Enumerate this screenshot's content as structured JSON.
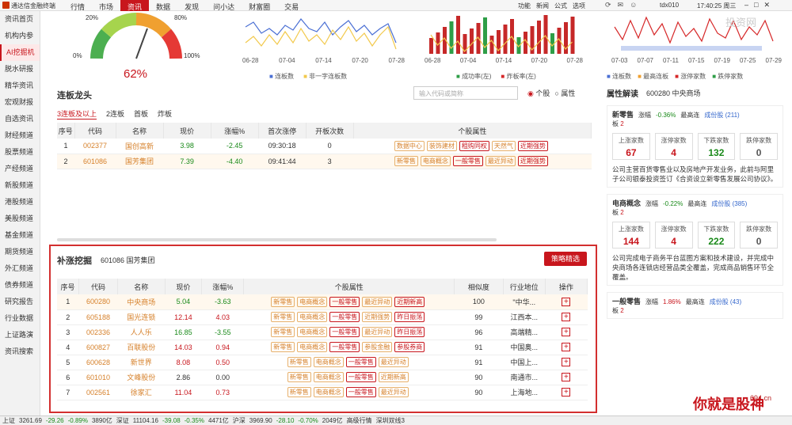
{
  "app": {
    "title": "通达信金融终端"
  },
  "menu": [
    "行情",
    "市场",
    "资讯",
    "数据",
    "发现",
    "问小达",
    "财富圈",
    "交易"
  ],
  "menu_active": "资讯",
  "right_menu": [
    "功能",
    "新闻",
    "公式",
    "选项"
  ],
  "account": "tdx010",
  "clock": "17:40:25 周三",
  "sidebar": [
    "资讯首页",
    "机构内参",
    "AI挖掘机",
    "脱水研报",
    "精华资讯",
    "宏观财报",
    "自选资讯",
    "财经频道",
    "股票频道",
    "产经频道",
    "新股频道",
    "港股频道",
    "美股频道",
    "基金频道",
    "期货频道",
    "外汇频道",
    "债券频道",
    "研究报告",
    "行业数据",
    "上证路演",
    "资讯搜索"
  ],
  "sidebar_active": "AI挖掘机",
  "gauge": {
    "value": "62%",
    "l20": "20%",
    "l80": "80%",
    "l0": "0%",
    "l100": "100%"
  },
  "chart1": {
    "legend": [
      "连板数",
      "非一字连板数"
    ],
    "x": [
      "06-28",
      "07-04",
      "07-14",
      "07-20",
      "07-28"
    ]
  },
  "chart2": {
    "legend": [
      "成功率(左)",
      "炸板率(左)"
    ],
    "x": [
      "06-28",
      "07-04",
      "07-14",
      "07-20",
      "07-28"
    ]
  },
  "chart3": {
    "legend": [
      "连板数",
      "最高连板",
      "涨停家数",
      "跌停家数"
    ],
    "x": [
      "07-03",
      "07-07",
      "07-11",
      "07-15",
      "07-19",
      "07-25",
      "07-29"
    ]
  },
  "dragon": {
    "title": "连板龙头",
    "search_placeholder": "输入代码或简称",
    "radio1": "个股",
    "radio2": "属性",
    "tabs": [
      "3连板及以上",
      "2连板",
      "首板",
      "炸板"
    ],
    "headers": [
      "序号",
      "代码",
      "名称",
      "现价",
      "涨幅%",
      "首次涨停",
      "开板次数",
      "个股属性"
    ],
    "rows": [
      {
        "n": "1",
        "code": "002377",
        "name": "国创高新",
        "price": "3.98",
        "chg": "-2.45",
        "first": "09:30:18",
        "opens": "0",
        "tags": [
          "数据中心",
          "装饰建材",
          "租购同权",
          "天然气",
          "近期强势"
        ]
      },
      {
        "n": "2",
        "code": "601086",
        "name": "国芳集团",
        "price": "7.39",
        "chg": "-4.40",
        "first": "09:41:44",
        "opens": "3",
        "tags": [
          "新零售",
          "电商概念",
          "一般零售",
          "最近异动",
          "近期强势"
        ]
      }
    ]
  },
  "mining": {
    "title": "补涨挖掘",
    "subtitle": "601086 国芳集团",
    "button": "策略精选",
    "headers": [
      "序号",
      "代码",
      "名称",
      "现价",
      "涨幅%",
      "个股属性",
      "相似度",
      "行业地位",
      "操作"
    ],
    "rows": [
      {
        "n": "1",
        "code": "600280",
        "name": "中央商场",
        "price": "5.04",
        "chg": "-3.63",
        "tags": [
          "新零售",
          "电商概念",
          "一般零售",
          "最近异动",
          "近期新高"
        ],
        "sim": "100",
        "ind": "\"中华..."
      },
      {
        "n": "2",
        "code": "605188",
        "name": "国光连锁",
        "price": "12.14",
        "chg": "4.03",
        "tags": [
          "新零售",
          "电商概念",
          "一般零售",
          "近期强势",
          "昨日振荡"
        ],
        "sim": "99",
        "ind": "江西本..."
      },
      {
        "n": "3",
        "code": "002336",
        "name": "人人乐",
        "price": "16.85",
        "chg": "-3.55",
        "tags": [
          "新零售",
          "电商概念",
          "一般零售",
          "最近异动",
          "昨日振荡"
        ],
        "sim": "96",
        "ind": "高端精..."
      },
      {
        "n": "4",
        "code": "600827",
        "name": "百联股份",
        "price": "14.03",
        "chg": "0.94",
        "tags": [
          "新零售",
          "电商概念",
          "一般零售",
          "参股金融",
          "参股券商"
        ],
        "sim": "91",
        "ind": "中国奥..."
      },
      {
        "n": "5",
        "code": "600628",
        "name": "新世界",
        "price": "8.08",
        "chg": "0.50",
        "tags": [
          "新零售",
          "电商概念",
          "一般零售",
          "最近异动"
        ],
        "sim": "91",
        "ind": "中国上..."
      },
      {
        "n": "6",
        "code": "601010",
        "name": "文峰股份",
        "price": "2.86",
        "chg": "0.00",
        "tags": [
          "新零售",
          "电商概念",
          "一般零售",
          "近期新高"
        ],
        "sim": "90",
        "ind": "南通市..."
      },
      {
        "n": "7",
        "code": "002561",
        "name": "徐家汇",
        "price": "11.04",
        "chg": "0.73",
        "tags": [
          "新零售",
          "电商概念",
          "一般零售",
          "最近异动"
        ],
        "sim": "90",
        "ind": "上海地..."
      }
    ]
  },
  "attr": {
    "title": "属性解读",
    "stock": "600280 中央商场",
    "cards": [
      {
        "name": "新零售",
        "board_label": "板",
        "board": "2",
        "chg_label": "涨幅",
        "chg": "-0.36%",
        "high_label": "最高连",
        "count_label": "成份股",
        "count": "(211)",
        "stats": [
          [
            "上涨家数",
            "67"
          ],
          [
            "涨停家数",
            "4"
          ],
          [
            "下跌家数",
            "132"
          ],
          [
            "跌停家数",
            "0"
          ]
        ],
        "desc": "公司主营百货零售业以及房地产开发业务，此前与阿里子公司银泰投资签订《合资设立新零售发展公司协议》。"
      },
      {
        "name": "电商概念",
        "board_label": "板",
        "board": "2",
        "chg_label": "涨幅",
        "chg": "-0.22%",
        "high_label": "最高连",
        "count_label": "成份股",
        "count": "(385)",
        "stats": [
          [
            "上涨家数",
            "144"
          ],
          [
            "涨停家数",
            "4"
          ],
          [
            "下跌家数",
            "222"
          ],
          [
            "跌停家数",
            "0"
          ]
        ],
        "desc": "公司完成电子商务平台蓝图方案和技术建设，并完成中央商场各连锁店经营品类全覆盖，完成商品销售环节全覆盖。"
      },
      {
        "name": "一般零售",
        "board_label": "板",
        "board": "2",
        "chg_label": "涨幅",
        "chg": "1.86%",
        "high_label": "最高连",
        "count_label": "成份股",
        "count": "(43)",
        "stats": [],
        "desc": ""
      }
    ]
  },
  "status": [
    "上证",
    "3261.69",
    "-29.26",
    "-0.89%",
    "3890亿",
    "深证",
    "11104.16",
    "-39.08",
    "-0.35%",
    "4471亿",
    "沪深",
    "3969.90",
    "-28.10",
    "-0.70%",
    "2049亿",
    "高级行情",
    "深圳双线3"
  ],
  "watermark": "投资网",
  "promo": "你就是股神",
  "promo_site": "694.cn"
}
